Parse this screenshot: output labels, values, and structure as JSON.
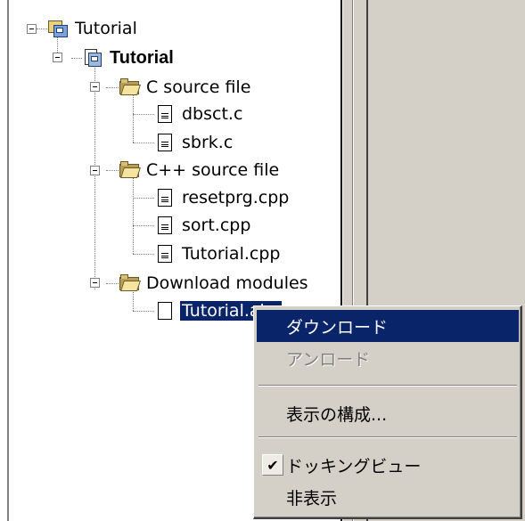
{
  "tree": {
    "workspace": {
      "label": "Tutorial"
    },
    "project": {
      "label": "Tutorial"
    },
    "folders": [
      {
        "label": "C source file",
        "files": [
          "dbsct.c",
          "sbrk.c"
        ]
      },
      {
        "label": "C++ source file",
        "files": [
          "resetprg.cpp",
          "sort.cpp",
          "Tutorial.cpp"
        ]
      },
      {
        "label": "Download modules",
        "files": [
          "Tutorial.abs"
        ]
      }
    ]
  },
  "context_menu": {
    "items": [
      {
        "label": "ダウンロード",
        "state": "highlighted"
      },
      {
        "label": "アンロード",
        "state": "disabled"
      },
      {
        "label": "表示の構成...",
        "state": "normal"
      },
      {
        "label": "ドッキングビュー",
        "state": "checked",
        "check_glyph": "✔"
      },
      {
        "label": "非表示",
        "state": "normal"
      }
    ]
  },
  "colors": {
    "selection": "#0a246a",
    "face": "#d4d0c8",
    "disabled_text": "#808080"
  }
}
